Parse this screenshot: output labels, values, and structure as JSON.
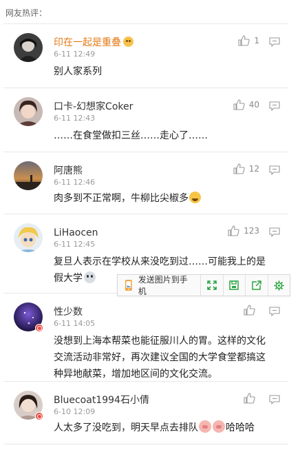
{
  "section_title": "网友热评：",
  "comments": [
    {
      "name": "印在一起是重叠",
      "time": "6-11 12:49",
      "likes": "1",
      "text": "别人家系列"
    },
    {
      "name": "口卡-幻想家Coker",
      "time": "6-11 12:43",
      "likes": "40",
      "text": "……在食堂做扣三丝……走心了……"
    },
    {
      "name": "阿唐熊",
      "time": "6-11 12:46",
      "likes": "12",
      "text": "肉多到不正常啊，牛柳比尖椒多"
    },
    {
      "name": "LiHaocen",
      "time": "6-11 12:45",
      "likes": "123",
      "text_line1": "复旦人表示在学校从来没吃到过……可能我上的是",
      "text_line2": "假大学"
    },
    {
      "name": "性少数",
      "time": "6-11 14:05",
      "likes": "",
      "text_line1": "没想到上海本帮菜也能征服川人的胃。这样的文化",
      "text_line2": "交流活动非常好，再次建议全国的大学食堂都搞这",
      "text_line3": "种异地献菜，增加地区间的文化交流。"
    },
    {
      "name": "Bluecoat1994石小倩",
      "time": "6-10 12:09",
      "likes": "",
      "text_a": "人太多了没吃到，明天早点去排队",
      "text_b": "哈哈哈"
    }
  ],
  "toolbar": {
    "send_label": "发送图片到手机"
  },
  "colors": {
    "accent_name": "#e47a16",
    "toolbar_green": "#2aa33f",
    "divider": "#e8e8e8"
  }
}
